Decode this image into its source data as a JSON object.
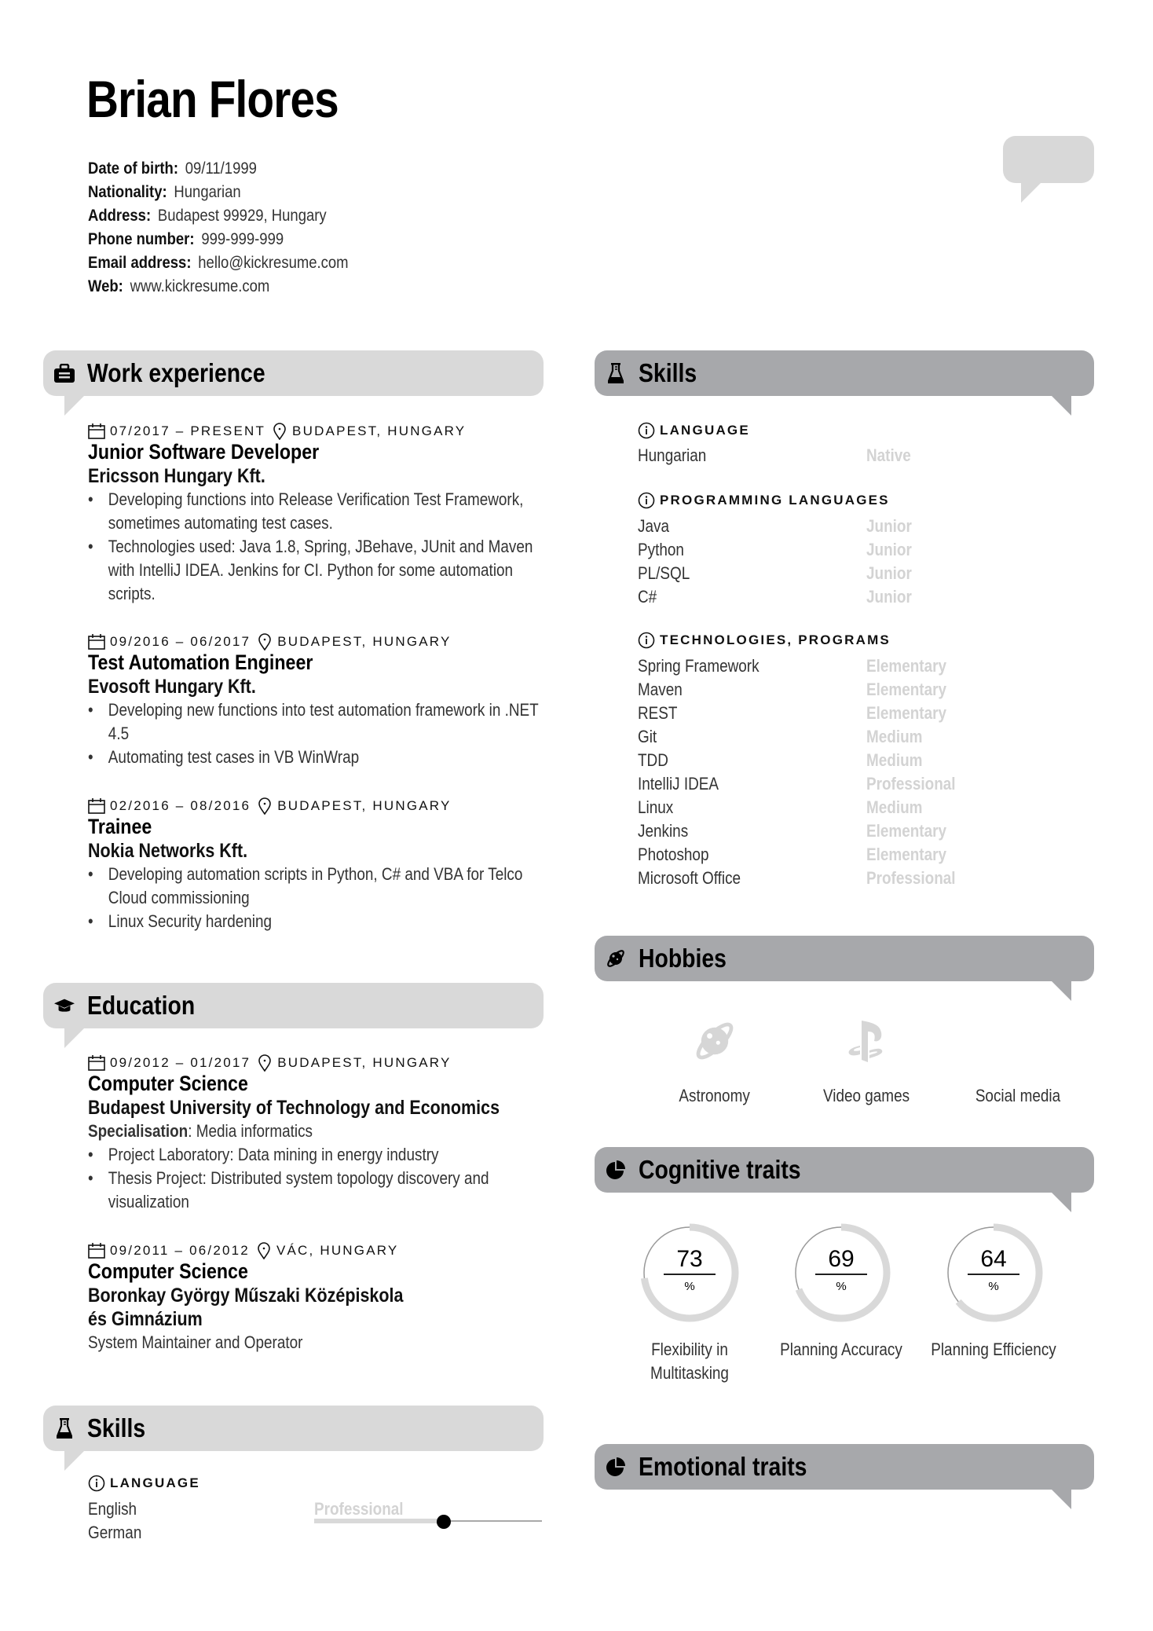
{
  "name": "Brian Flores",
  "personal_info": [
    {
      "label": "Date of birth:",
      "value": "09/11/1999"
    },
    {
      "label": "Nationality:",
      "value": "Hungarian"
    },
    {
      "label": "Address:",
      "value": "Budapest 99929, Hungary"
    },
    {
      "label": "Phone number:",
      "value": "999-999-999"
    },
    {
      "label": "Email address:",
      "value": "hello@kickresume.com"
    },
    {
      "label": "Web:",
      "value": "www.kickresume.com"
    }
  ],
  "sections": {
    "work": {
      "title": "Work experience",
      "icon": "briefcase-icon"
    },
    "education": {
      "title": "Education",
      "icon": "graduation-cap-icon"
    },
    "skills_left": {
      "title": "Skills",
      "icon": "flask-icon"
    },
    "skills_right": {
      "title": "Skills",
      "icon": "flask-icon"
    },
    "hobbies": {
      "title": "Hobbies",
      "icon": "planet-icon"
    },
    "cognitive": {
      "title": "Cognitive traits",
      "icon": "pie-chart-icon"
    },
    "emotional": {
      "title": "Emotional traits",
      "icon": "pie-chart-icon"
    }
  },
  "work": [
    {
      "dates": "07/2017 – PRESENT",
      "location": "BUDAPEST, HUNGARY",
      "role": "Junior Software Developer",
      "company": "Ericsson Hungary Kft.",
      "bullets": [
        "Developing functions into Release Verification Test Framework, sometimes automating test cases.",
        "Technologies used: Java 1.8, Spring, JBehave, JUnit and Maven with IntelliJ IDEA. Jenkins for CI. Python for some automation scripts."
      ]
    },
    {
      "dates": "09/2016 – 06/2017",
      "location": "BUDAPEST, HUNGARY",
      "role": "Test Automation Engineer",
      "company": "Evosoft Hungary Kft.",
      "bullets": [
        "Developing new functions into test automation framework in .NET 4.5",
        "Automating test cases in VB WinWrap"
      ]
    },
    {
      "dates": "02/2016 – 08/2016",
      "location": "BUDAPEST, HUNGARY",
      "role": "Trainee",
      "company": "Nokia Networks Kft.",
      "bullets": [
        "Developing automation scripts in Python, C# and VBA for Telco Cloud commissioning",
        "Linux Security hardening"
      ]
    }
  ],
  "education": [
    {
      "dates": "09/2012 – 01/2017",
      "location": "BUDAPEST, HUNGARY",
      "field": "Computer Science",
      "school": "Budapest University of Technology and Economics",
      "spec_label": "Specialisation",
      "spec_value": ": Media informatics",
      "bullets": [
        "Project Laboratory: Data mining in energy industry",
        "Thesis Project: Distributed system topology discovery and visualization"
      ]
    },
    {
      "dates": "09/2011 – 06/2012",
      "location": "VÁC, HUNGARY",
      "field": "Computer Science",
      "school": "Boronkay György Műszaki Középiskola és Gimnázium",
      "description": "System Maintainer and Operator"
    }
  ],
  "skills_left": {
    "category": "LANGUAGE",
    "items": [
      {
        "name": "English",
        "level": "Professional"
      },
      {
        "name": "German",
        "level_fraction": 0.57
      }
    ]
  },
  "skills_right": [
    {
      "category": "LANGUAGE",
      "items": [
        {
          "name": "Hungarian",
          "level": "Native"
        }
      ]
    },
    {
      "category": "PROGRAMMING LANGUAGES",
      "items": [
        {
          "name": "Java",
          "level": "Junior"
        },
        {
          "name": "Python",
          "level": "Junior"
        },
        {
          "name": "PL/SQL",
          "level": "Junior"
        },
        {
          "name": "C#",
          "level": "Junior"
        }
      ]
    },
    {
      "category": "TECHNOLOGIES, PROGRAMS",
      "items": [
        {
          "name": "Spring Framework",
          "level": "Elementary"
        },
        {
          "name": "Maven",
          "level": "Elementary"
        },
        {
          "name": "REST",
          "level": "Elementary"
        },
        {
          "name": "Git",
          "level": "Medium"
        },
        {
          "name": "TDD",
          "level": "Medium"
        },
        {
          "name": "IntelliJ IDEA",
          "level": "Professional"
        },
        {
          "name": "Linux",
          "level": "Medium"
        },
        {
          "name": "Jenkins",
          "level": "Elementary"
        },
        {
          "name": "Photoshop",
          "level": "Elementary"
        },
        {
          "name": "Microsoft Office",
          "level": "Professional"
        }
      ]
    }
  ],
  "hobbies": [
    {
      "label": "Astronomy",
      "icon": "planet-icon"
    },
    {
      "label": "Video games",
      "icon": "playstation-icon"
    },
    {
      "label": "Social media",
      "icon": ""
    }
  ],
  "cognitive_traits": [
    {
      "value": 73,
      "unit": "%",
      "label": "Flexibility in Multitasking"
    },
    {
      "value": 69,
      "unit": "%",
      "label": "Planning Accuracy"
    },
    {
      "value": 64,
      "unit": "%",
      "label": "Planning Efficiency"
    }
  ],
  "colors": {
    "header_left": "#d9d9d9",
    "header_right": "#a7a8ab",
    "level_text": "#d3d3d3",
    "gauge_fill": "#d9d9d9",
    "gauge_rest": "#999999"
  }
}
